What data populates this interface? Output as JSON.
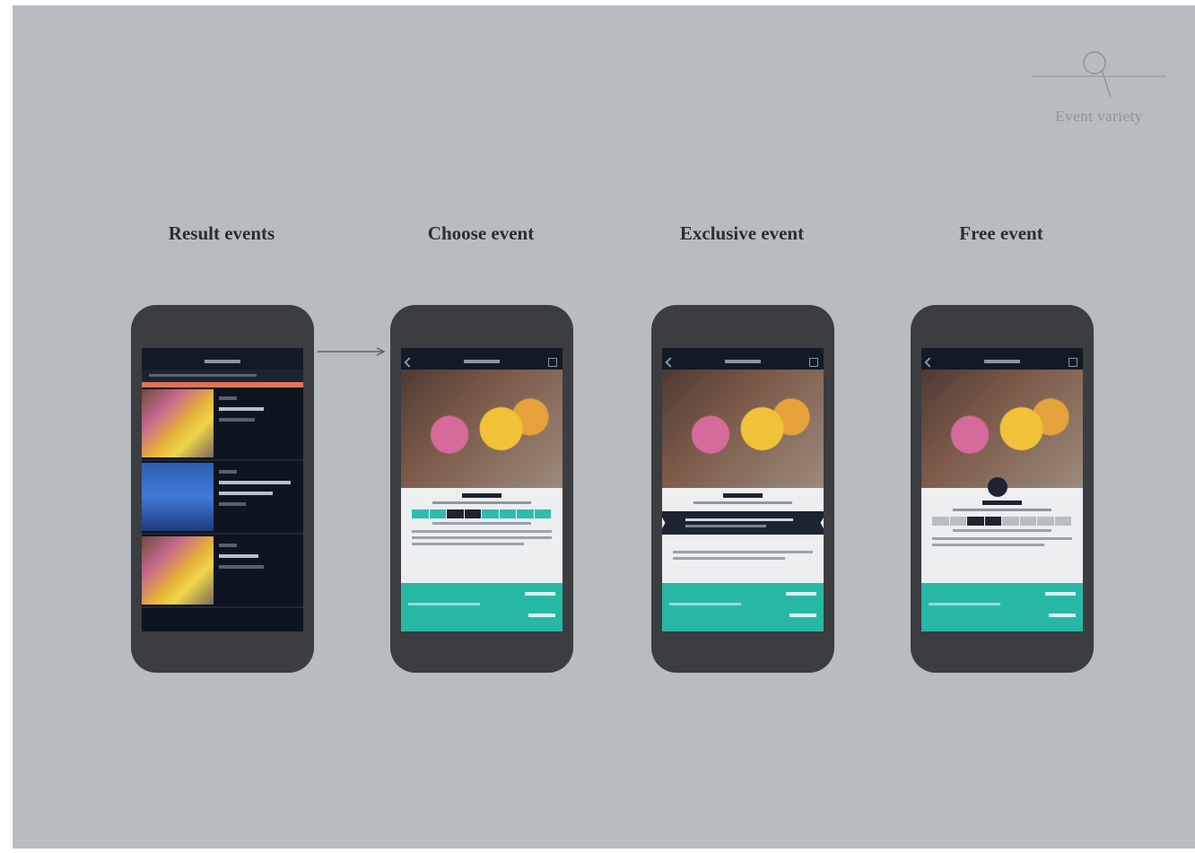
{
  "brand": {
    "logo_text": "Event variety"
  },
  "screens": [
    {
      "title": "Result events"
    },
    {
      "title": "Choose event"
    },
    {
      "title": "Exclusive event"
    },
    {
      "title": "Free event"
    }
  ],
  "colors": {
    "background": "#b7bcc1",
    "phone": "#3b3d40",
    "accent_teal": "#27b8a5",
    "accent_orange": "#e07456",
    "dark_ui": "#0e1521"
  }
}
